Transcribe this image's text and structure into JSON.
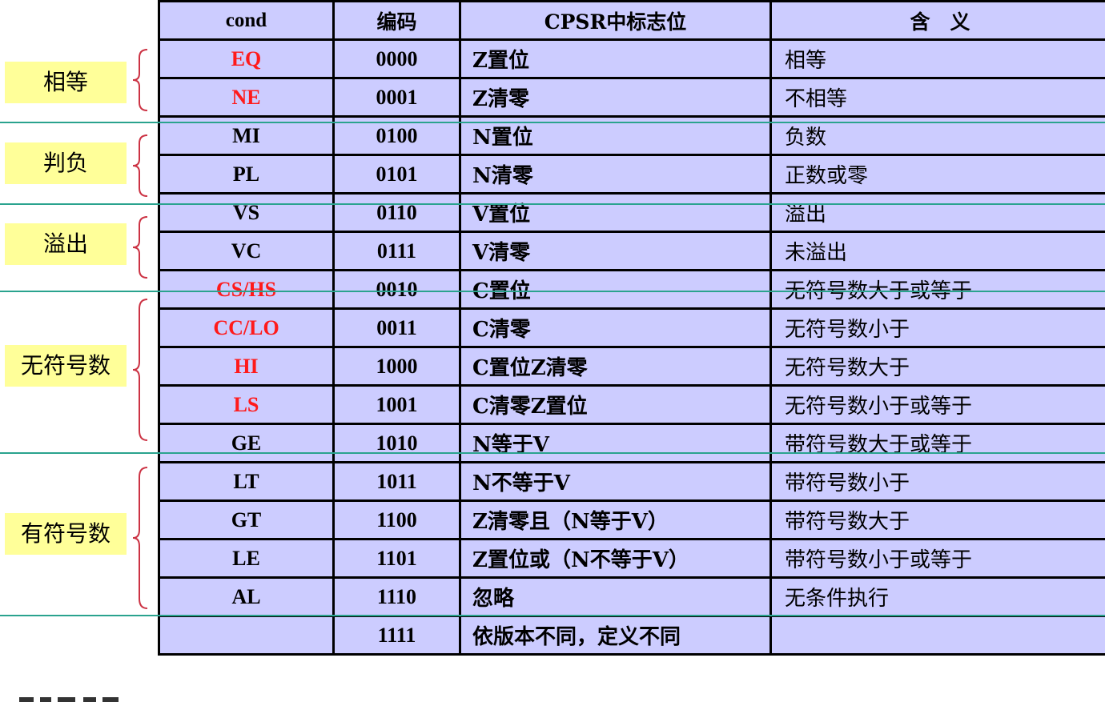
{
  "headers": {
    "cond": "cond",
    "code": "编码",
    "flag": "CPSR中标志位",
    "meaning": "含　义"
  },
  "rows": [
    {
      "cond": "EQ",
      "code": "0000",
      "flag": "Z置位",
      "meaning": "相等",
      "highlight": true
    },
    {
      "cond": "NE",
      "code": "0001",
      "flag": "Z清零",
      "meaning": "不相等",
      "highlight": true
    },
    {
      "cond": "MI",
      "code": "0100",
      "flag": "N置位",
      "meaning": "负数",
      "highlight": false
    },
    {
      "cond": "PL",
      "code": "0101",
      "flag": "N清零",
      "meaning": "正数或零",
      "highlight": false
    },
    {
      "cond": "VS",
      "code": "0110",
      "flag": "V置位",
      "meaning": "溢出",
      "highlight": false
    },
    {
      "cond": "VC",
      "code": "0111",
      "flag": "V清零",
      "meaning": "未溢出",
      "highlight": false
    },
    {
      "cond": "CS/HS",
      "code": "0010",
      "flag": "C置位",
      "meaning": "无符号数大于或等于",
      "highlight": true
    },
    {
      "cond": "CC/LO",
      "code": "0011",
      "flag": "C清零",
      "meaning": "无符号数小于",
      "highlight": true
    },
    {
      "cond": "HI",
      "code": "1000",
      "flag": "C置位Z清零",
      "meaning": "无符号数大于",
      "highlight": true
    },
    {
      "cond": "LS",
      "code": "1001",
      "flag": "C清零Z置位",
      "meaning": "无符号数小于或等于",
      "highlight": true
    },
    {
      "cond": "GE",
      "code": "1010",
      "flag": "N等于V",
      "meaning": "带符号数大于或等于",
      "highlight": false
    },
    {
      "cond": "LT",
      "code": "1011",
      "flag": "N不等于V",
      "meaning": "带符号数小于",
      "highlight": false
    },
    {
      "cond": "GT",
      "code": "1100",
      "flag": "Z清零且（N等于V）",
      "meaning": "带符号数大于",
      "highlight": false
    },
    {
      "cond": "LE",
      "code": "1101",
      "flag": "Z置位或（N不等于V）",
      "meaning": "带符号数小于或等于",
      "highlight": false
    },
    {
      "cond": "AL",
      "code": "1110",
      "flag": "忽略",
      "meaning": "无条件执行",
      "highlight": false
    },
    {
      "cond": "",
      "code": "1111",
      "flag": "依版本不同，定义不同",
      "meaning": "",
      "highlight": false
    }
  ],
  "groups": [
    {
      "label": "相等"
    },
    {
      "label": "判负"
    },
    {
      "label": "溢出"
    },
    {
      "label": "无符号数"
    },
    {
      "label": "有符号数"
    }
  ],
  "colors": {
    "cell_bg": "#ccccff",
    "label_bg": "#ffff99",
    "highlight_text": "#ff1a1a",
    "brace": "#cc3344",
    "separator": "#2aa38e"
  }
}
